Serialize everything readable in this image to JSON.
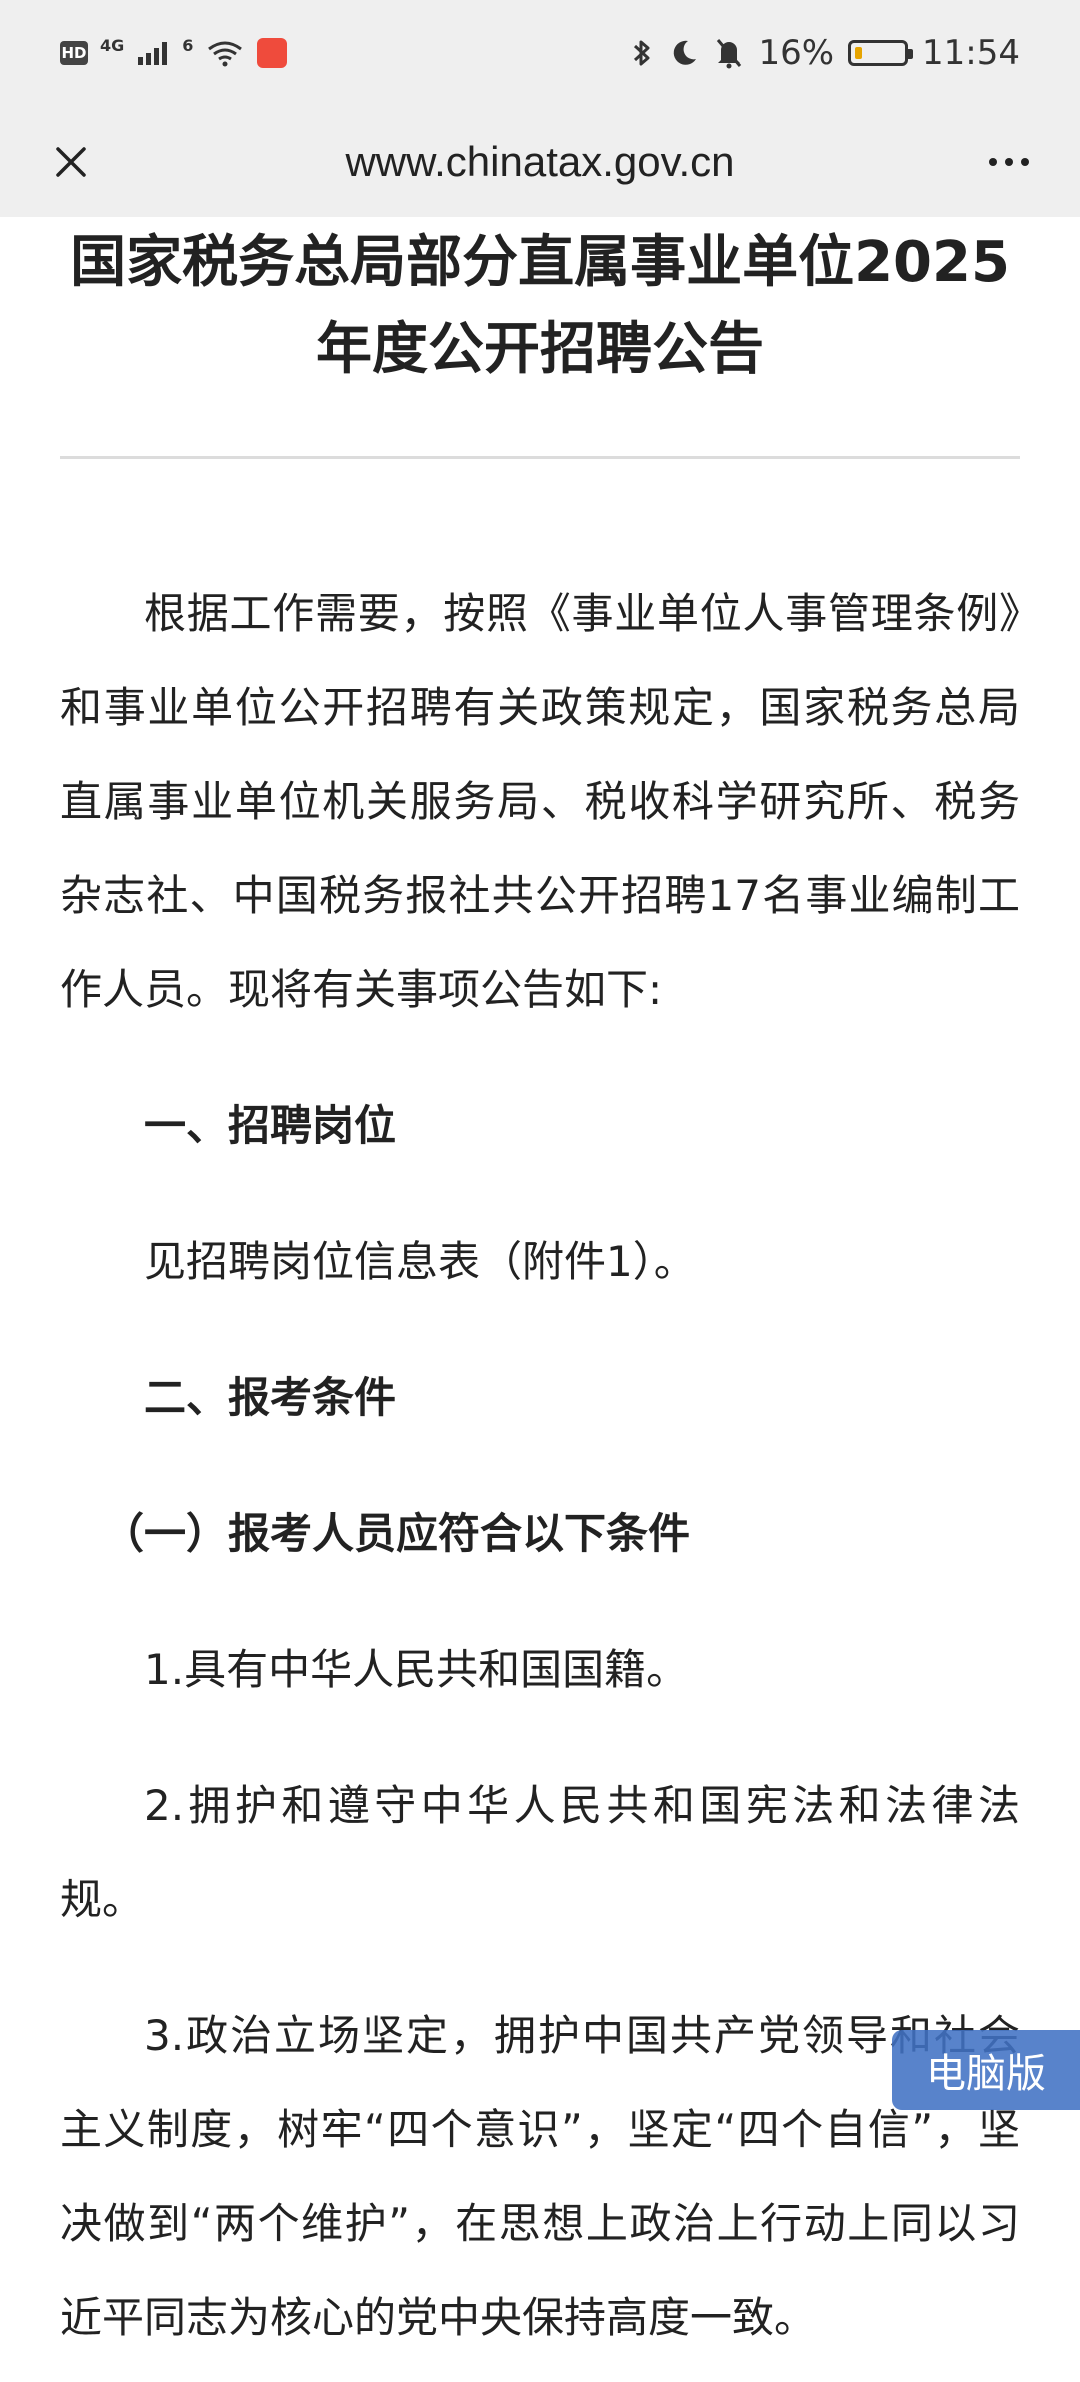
{
  "status_bar": {
    "left_badges": [
      "HD",
      "4G",
      "6"
    ],
    "battery": "16%",
    "battery_level": 0.16,
    "time": "11:54",
    "colors": {
      "battery_fill": "#e6a400",
      "app_badge": "#ef4b3c"
    },
    "icons": [
      "hd-icon",
      "signal-icon",
      "wifi-icon",
      "app-badge-icon",
      "bluetooth-icon",
      "moon-icon",
      "mute-bell-icon",
      "battery-icon"
    ]
  },
  "browser": {
    "url": "www.chinatax.gov.cn",
    "close_icon": "close-icon",
    "menu_icon": "more-icon"
  },
  "article": {
    "title": "国家税务总局部分直属事业单位2025年度公开招聘公告",
    "intro": "根据工作需要，按照《事业单位人事管理条例》和事业单位公开招聘有关政策规定，国家税务总局直属事业单位机关服务局、税收科学研究所、税务杂志社、中国税务报社共公开招聘17名事业编制工作人员。现将有关事项公告如下:",
    "section_1_heading": "一、招聘岗位",
    "section_1_text": "见招聘岗位信息表（附件1）。",
    "section_2_heading": "二、报考条件",
    "sub_heading_1": "（一）报考人员应符合以下条件",
    "item_1": "1.具有中华人民共和国国籍。",
    "item_2": "2.拥护和遵守中华人民共和国宪法和法律法规。",
    "item_3": "3.政治立场坚定，拥护中国共产党领导和社会主义制度，树牢“四个意识”，坚定“四个自信”，坚决做到“两个维护”，在思想上政治上行动上同以习近平同志为核心的党中央保持高度一致。"
  },
  "floating_button": {
    "label": "电脑版"
  }
}
